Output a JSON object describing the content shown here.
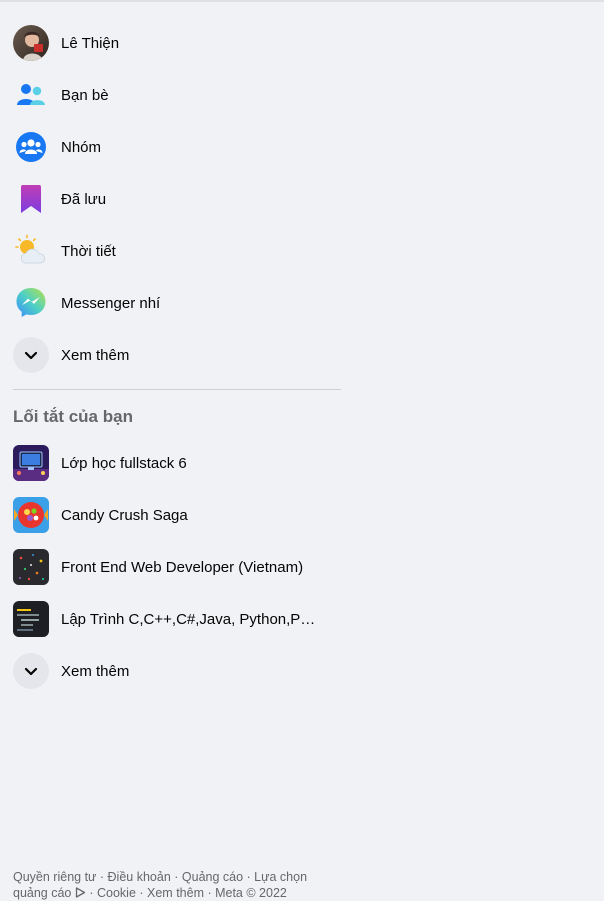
{
  "profile": {
    "name": "Lê Thiện"
  },
  "nav": {
    "friends": "Bạn bè",
    "groups": "Nhóm",
    "saved": "Đã lưu",
    "weather": "Thời tiết",
    "messenger_kids": "Messenger nhí",
    "see_more": "Xem thêm"
  },
  "shortcuts": {
    "title": "Lối tắt của bạn",
    "items": [
      {
        "label": "Lớp học fullstack 6"
      },
      {
        "label": "Candy Crush Saga"
      },
      {
        "label": "Front End Web Developer (Vietnam)"
      },
      {
        "label": "Lập Trình C,C++,C#,Java, Python,PHP..."
      }
    ],
    "see_more": "Xem thêm"
  },
  "footer": {
    "privacy": "Quyền riêng tư",
    "terms": "Điều khoản",
    "ads": "Quảng cáo",
    "ad_choices": "Lựa chọn quảng cáo",
    "cookies": "Cookie",
    "more": "Xem thêm",
    "copyright": "Meta © 2022",
    "separator": " · "
  },
  "colors": {
    "background": "#f0f2f5",
    "text": "#050505",
    "secondary_text": "#65676b",
    "accent_blue": "#1877f2",
    "divider": "#ced0d4"
  }
}
